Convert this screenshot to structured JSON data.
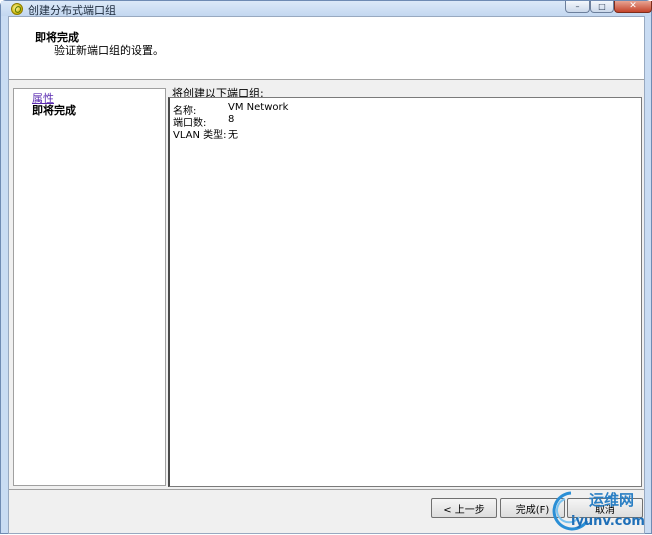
{
  "window": {
    "title": "创建分布式端口组",
    "controls": {
      "minimize": "–",
      "maximize": "□",
      "close": "✕"
    }
  },
  "header": {
    "title": "即将完成",
    "subtitle": "验证新端口组的设置。"
  },
  "nav": {
    "items": [
      {
        "label": "属性",
        "state": "link"
      },
      {
        "label": "即将完成",
        "state": "current"
      }
    ]
  },
  "content": {
    "label": "将创建以下端口组:",
    "rows": [
      {
        "key": "名称:",
        "value": "VM Network"
      },
      {
        "key": "端口数:",
        "value": "8"
      },
      {
        "key": "VLAN 类型:",
        "value": "无"
      }
    ]
  },
  "footer": {
    "back_label": "< 上一步",
    "finish_label": "完成(F)",
    "cancel_label": "取消"
  },
  "watermark": {
    "text": "运维网",
    "url": "iyunv.com"
  },
  "colors": {
    "title_bar": "#c9dcf3",
    "link": "#5a2bb0",
    "dialog_bg": "#f0f0f0"
  }
}
